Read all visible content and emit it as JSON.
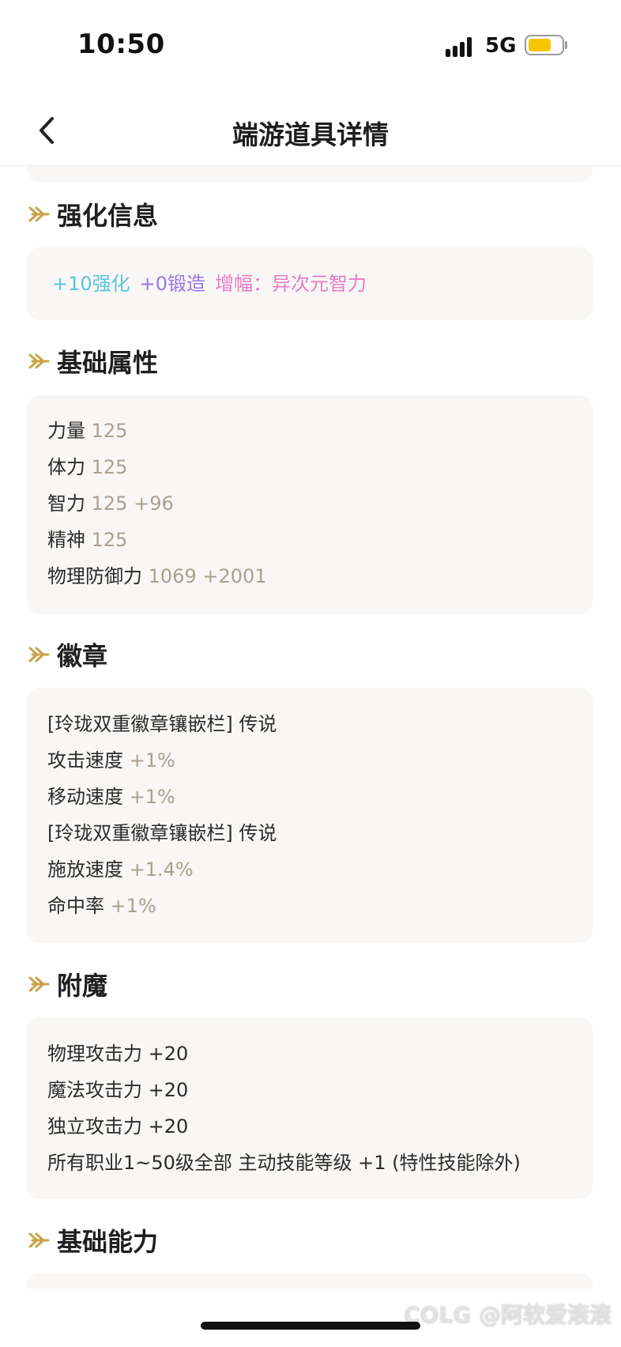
{
  "status": {
    "time": "10:50",
    "network": "5G",
    "battery_color": "#f7c600"
  },
  "nav": {
    "title": "端游道具详情",
    "back_icon": "chevron-left-icon"
  },
  "sections": {
    "enhance": {
      "title": "强化信息",
      "refine": "+10强化",
      "forge": "+0锻造",
      "amplify": "增幅：异次元智力",
      "colors": {
        "refine": "#58c4e0",
        "forge": "#9b74e8",
        "amplify": "#e77bc8"
      }
    },
    "base_attrs": {
      "title": "基础属性",
      "rows": [
        {
          "label": "力量",
          "value": "125"
        },
        {
          "label": "体力",
          "value": "125"
        },
        {
          "label": "智力",
          "value": "125 +96"
        },
        {
          "label": "精神",
          "value": "125"
        },
        {
          "label": "物理防御力",
          "value": "1069 +2001"
        }
      ]
    },
    "emblem": {
      "title": "徽章",
      "rows": [
        {
          "label": "[玲珑双重徽章镶嵌栏] 传说",
          "value": ""
        },
        {
          "label": "攻击速度",
          "value": "+1%"
        },
        {
          "label": "移动速度",
          "value": "+1%"
        },
        {
          "label": "[玲珑双重徽章镶嵌栏] 传说",
          "value": ""
        },
        {
          "label": "施放速度",
          "value": "+1.4%"
        },
        {
          "label": "命中率",
          "value": "+1%"
        }
      ]
    },
    "enchant": {
      "title": "附魔",
      "rows": [
        "物理攻击力 +20",
        "魔法攻击力 +20",
        "独立攻击力 +20",
        "所有职业1~50级全部 主动技能等级 +1 (特性技能除外)"
      ]
    },
    "base_ability": {
      "title": "基础能力"
    }
  },
  "watermark": "COLG @阿软爱滚滚",
  "accent_color": "#c9a24a",
  "value_color": "#aba08f"
}
